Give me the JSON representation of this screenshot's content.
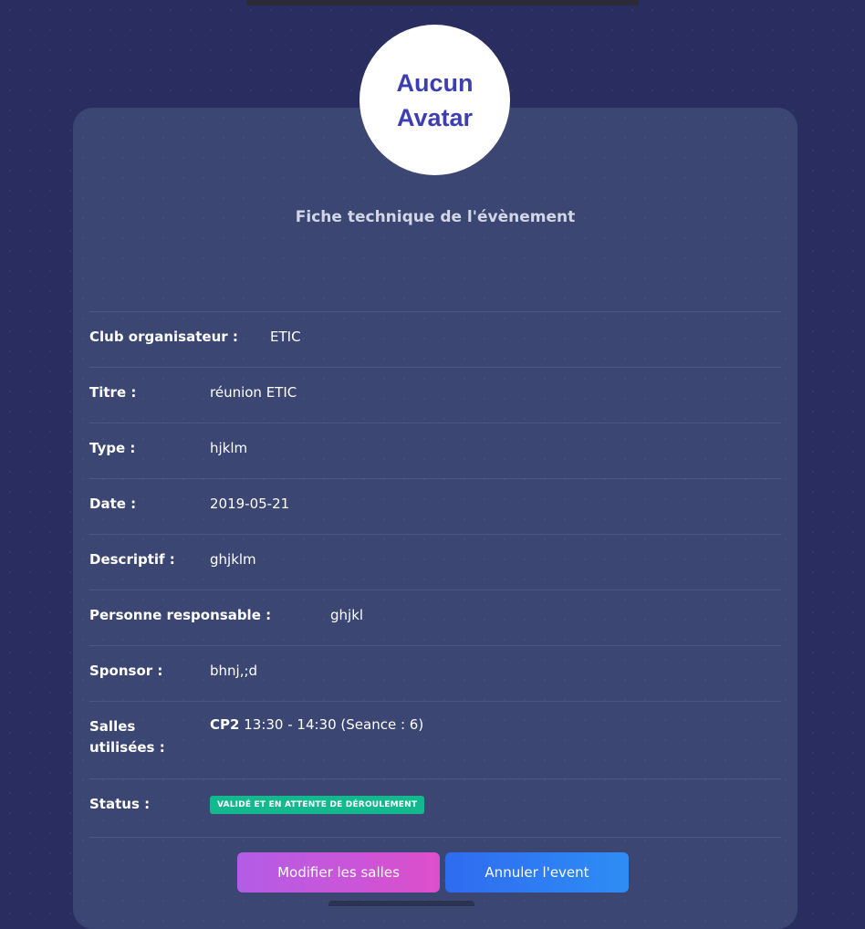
{
  "avatar": {
    "text": "Aucun Avatar"
  },
  "card": {
    "title": "Fiche technique de l'évènement"
  },
  "details": {
    "club": {
      "label": "Club organisateur :",
      "value": "ETIC"
    },
    "titre": {
      "label": "Titre :",
      "value": "réunion ETIC"
    },
    "type": {
      "label": "Type :",
      "value": "hjklm"
    },
    "date": {
      "label": "Date :",
      "value": "2019-05-21"
    },
    "descriptif": {
      "label": "Descriptif :",
      "value": "ghjklm"
    },
    "responsable": {
      "label": "Personne responsable :",
      "value": "ghjkl"
    },
    "sponsor": {
      "label": "Sponsor :",
      "value": "bhnj,;d"
    },
    "salles": {
      "label": "Salles utilisées :",
      "room": "CP2",
      "time": "13:30 - 14:30 (Seance : 6)"
    },
    "status": {
      "label": "Status :",
      "badge": "VALIDÉ ET EN ATTENTE DE DÉROULEMENT",
      "badge_color": "#14b88e"
    }
  },
  "actions": {
    "edit_rooms": "Modifier les salles",
    "cancel_event": "Annuler l'event"
  }
}
